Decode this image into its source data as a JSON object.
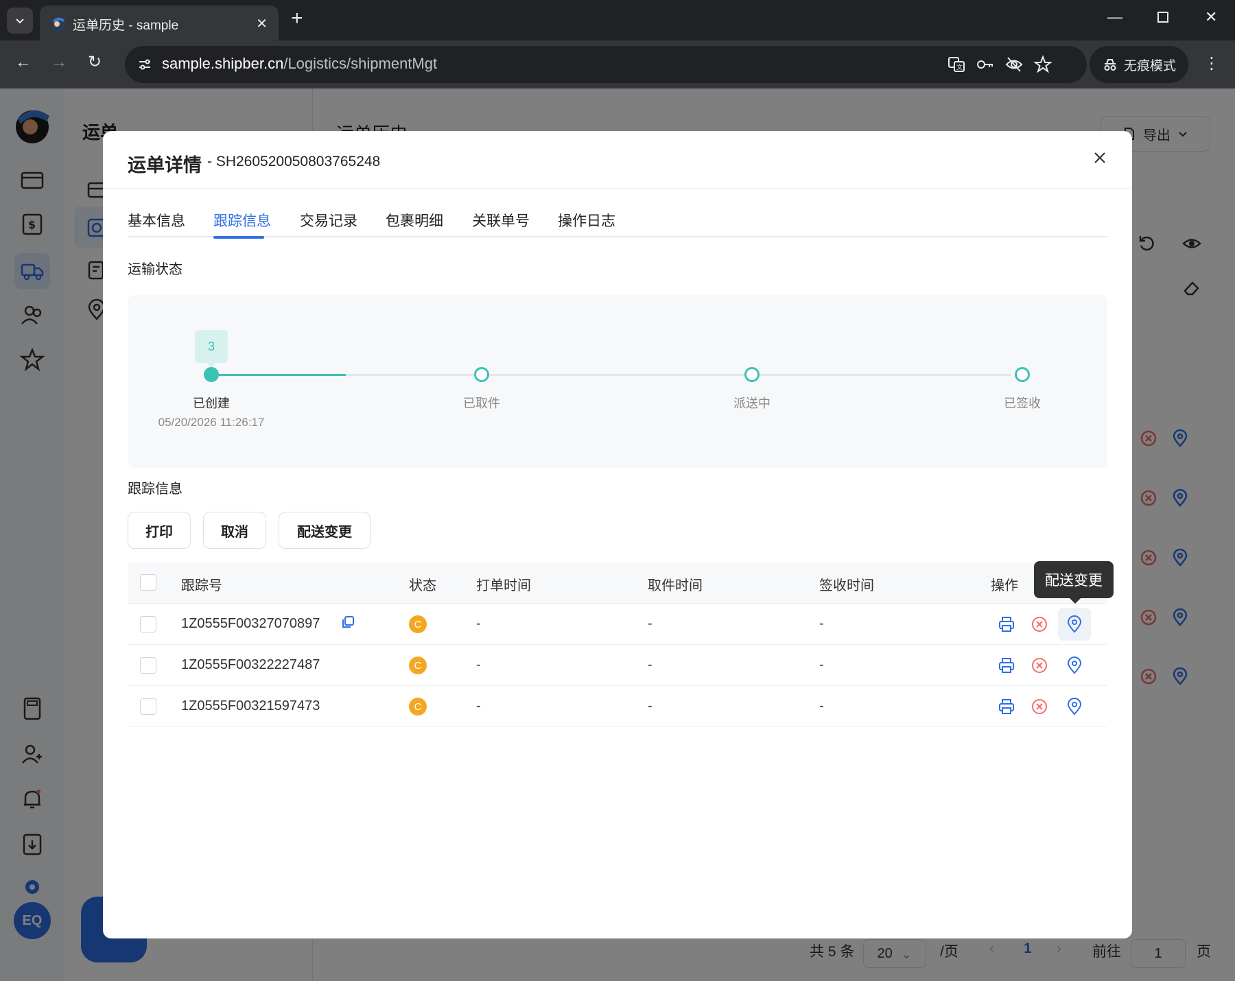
{
  "browser": {
    "tab_title": "运单历史 - sample",
    "url_host": "sample.shipber.cn",
    "url_path": "/Logistics/shipmentMgt",
    "incognito_label": "无痕模式"
  },
  "app": {
    "sub_title": "运单",
    "page_title": "运单历史",
    "export_label": "导出",
    "avatar_initials": "EQ",
    "pager": {
      "total": "共 5 条",
      "page_size": "20",
      "per_page": "/页",
      "current": "1",
      "goto_label": "前往",
      "goto_value": "1",
      "page_unit": "页"
    }
  },
  "modal": {
    "title": "运单详情",
    "shipment_no": "- SH260520050803765248",
    "tabs": [
      "基本信息",
      "跟踪信息",
      "交易记录",
      "包裹明细",
      "关联单号",
      "操作日志"
    ],
    "active_tab": 1,
    "status_section": "运输状态",
    "tracking_section": "跟踪信息",
    "timeline": {
      "count_badge": "3",
      "steps": [
        {
          "label": "已创建",
          "time": "05/20/2026 11:26:17",
          "done": true
        },
        {
          "label": "已取件",
          "time": "",
          "done": false
        },
        {
          "label": "派送中",
          "time": "",
          "done": false
        },
        {
          "label": "已签收",
          "time": "",
          "done": false
        }
      ]
    },
    "buttons": {
      "print": "打印",
      "cancel": "取消",
      "change": "配送变更"
    },
    "table": {
      "headers": {
        "tracking_no": "跟踪号",
        "status": "状态",
        "print_time": "打单时间",
        "pickup_time": "取件时间",
        "sign_time": "签收时间",
        "ops": "操作"
      },
      "rows": [
        {
          "tracking_no": "1Z0555F00327070897",
          "status": "C",
          "print_time": "-",
          "pickup_time": "-",
          "sign_time": "-"
        },
        {
          "tracking_no": "1Z0555F00322227487",
          "status": "C",
          "print_time": "-",
          "pickup_time": "-",
          "sign_time": "-"
        },
        {
          "tracking_no": "1Z0555F00321597473",
          "status": "C",
          "print_time": "-",
          "pickup_time": "-",
          "sign_time": "-"
        }
      ]
    },
    "tooltip": "配送变更"
  },
  "colors": {
    "accent": "#2f6fe6",
    "teal": "#3cc2b5",
    "status_orange": "#f5a623",
    "danger": "#f56c6c"
  }
}
